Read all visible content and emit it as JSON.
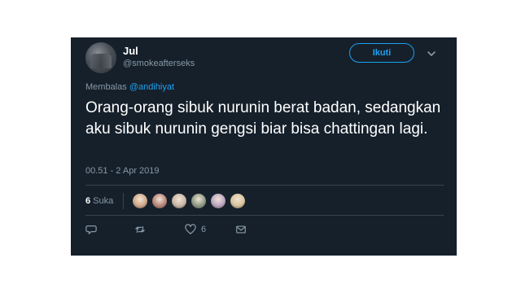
{
  "tweet": {
    "author_name": "Jul",
    "author_handle": "@smokeafterseks",
    "follow_label": "Ikuti",
    "reply_prefix": "Membalas",
    "reply_mention": "@andihiyat",
    "text": "Orang-orang sibuk nurunin berat badan, sedangkan aku sibuk nurunin gengsi biar bisa chattingan lagi.",
    "timestamp": "00.51 - 2 Apr 2019",
    "likes_count": "6",
    "likes_label": "Suka",
    "like_action_count": "6",
    "liker_avatars": [
      "#cfa98a",
      "#b8857a",
      "#c9b7a6",
      "#8c9a84",
      "#b9a5c2",
      "#d8c49c"
    ],
    "icons": [
      "reply-icon",
      "retweet-icon",
      "like-icon",
      "message-icon",
      "chevron-down-icon"
    ],
    "colors": {
      "background": "#15202b",
      "accent": "#1da1f2",
      "muted": "#8899a6"
    }
  }
}
